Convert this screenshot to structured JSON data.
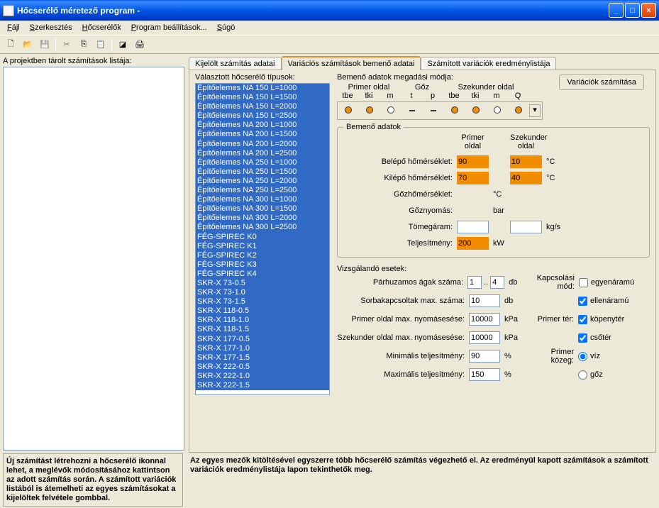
{
  "window": {
    "title": "Hőcserélő méretező program -"
  },
  "menu": [
    "Fájl",
    "Szerkesztés",
    "Hőcserélők",
    "Program beállítások...",
    "Súgó"
  ],
  "hint_left_label": "A projektben tárolt számítások listája:",
  "tabs": {
    "t1": "Kijelölt számítás adatai",
    "t2": "Variációs számítások bemenő adatai",
    "t3": "Számított variációk eredménylistája"
  },
  "types_label": "Választott hőcserélő típusok:",
  "types": [
    "Építőelemes NA 150 L=1000",
    "Építőelemes NA 150 L=1500",
    "Építőelemes NA 150 L=2000",
    "Építőelemes NA 150 L=2500",
    "Építőelemes NA 200 L=1000",
    "Építőelemes NA 200 L=1500",
    "Építőelemes NA 200 L=2000",
    "Építőelemes NA 200 L=2500",
    "Építőelemes NA 250 L=1000",
    "Építőelemes NA 250 L=1500",
    "Építőelemes NA 250 L=2000",
    "Építőelemes NA 250 L=2500",
    "Építőelemes NA 300 L=1000",
    "Építőelemes NA 300 L=1500",
    "Építőelemes NA 300 L=2000",
    "Építőelemes NA 300 L=2500",
    "FÉG-SPIREC K0",
    "FÉG-SPIREC K1",
    "FÉG-SPIREC K2",
    "FÉG-SPIREC K3",
    "FÉG-SPIREC K4",
    "SKR-X 73-0.5",
    "SKR-X 73-1.0",
    "SKR-X 73-1.5",
    "SKR-X 118-0.5",
    "SKR-X 118-1.0",
    "SKR-X 118-1.5",
    "SKR-X 177-0.5",
    "SKR-X 177-1.0",
    "SKR-X 177-1.5",
    "SKR-X 222-0.5",
    "SKR-X 222-1.0",
    "SKR-X 222-1.5"
  ],
  "input_mode": {
    "title": "Bemenő adatok megadási módja:",
    "groups": {
      "primer": "Primer oldal",
      "goz": "Gőz",
      "szekunder": "Szekunder oldal"
    },
    "sub": [
      "tbe",
      "tki",
      "m",
      "t",
      "p",
      "tbe",
      "tki",
      "m",
      "Q"
    ]
  },
  "calc_btn": "Variációk számítása",
  "fieldset_title": "Bemenő adatok",
  "headers": {
    "primer": "Primer\noldal",
    "szekunder": "Szekunder\noldal"
  },
  "rows": {
    "belepo": {
      "lbl": "Belépő hőmérséklet:",
      "p": "90",
      "s": "10",
      "unit": "°C"
    },
    "kilepo": {
      "lbl": "Kilépő hőmérséklet:",
      "p": "70",
      "s": "40",
      "unit": "°C"
    },
    "gozhom": {
      "lbl": "Gőzhőmérséklet:",
      "unit": "°C"
    },
    "goznyom": {
      "lbl": "Gőznyomás:",
      "unit": "bar"
    },
    "tomeg": {
      "lbl": "Tömegáram:",
      "unit": "kg/s"
    },
    "telj": {
      "lbl": "Teljesítmény:",
      "p": "200",
      "unit": "kW"
    }
  },
  "exam_title": "Vizsgálandó esetek:",
  "exam": {
    "parhuz": {
      "lbl": "Párhuzamos ágak száma:",
      "v1": "1",
      "v2": "4",
      "unit": "db"
    },
    "sorba": {
      "lbl": "Sorbakapcsoltak max. száma:",
      "v": "10",
      "unit": "db"
    },
    "primer_nyom": {
      "lbl": "Primer oldal max. nyomásesése:",
      "v": "10000",
      "unit": "kPa"
    },
    "szek_nyom": {
      "lbl": "Szekunder oldal max. nyomásesése:",
      "v": "10000",
      "unit": "kPa"
    },
    "min_telj": {
      "lbl": "Minimális teljesítmény:",
      "v": "90",
      "unit": "%"
    },
    "max_telj": {
      "lbl": "Maximális teljesítmény:",
      "v": "150",
      "unit": "%"
    }
  },
  "right_opts": {
    "kapcs": "Kapcsolási mód:",
    "egyen": "egyenáramú",
    "ellen": "ellenáramú",
    "primer_ter": "Primer tér:",
    "kopeny": "köpenytér",
    "csoter": "csőtér",
    "primer_kozeg": "Primer közeg:",
    "viz": "víz",
    "goz": "gőz"
  },
  "footer_left": "Új számítást létrehozni a hőcserélő ikonnal lehet, a meglévők módosításához kattintson az adott számítás során. A számított variációk listából is átemelheti az egyes számításokat a kijelöltek felvétele gombbal.",
  "footer_right": "Az egyes mezők kitöltésével egyszerre több hőcserélő számítás végezhető el. Az eredményül kapott számítások a számított variációk eredménylistája lapon tekinthetők meg."
}
